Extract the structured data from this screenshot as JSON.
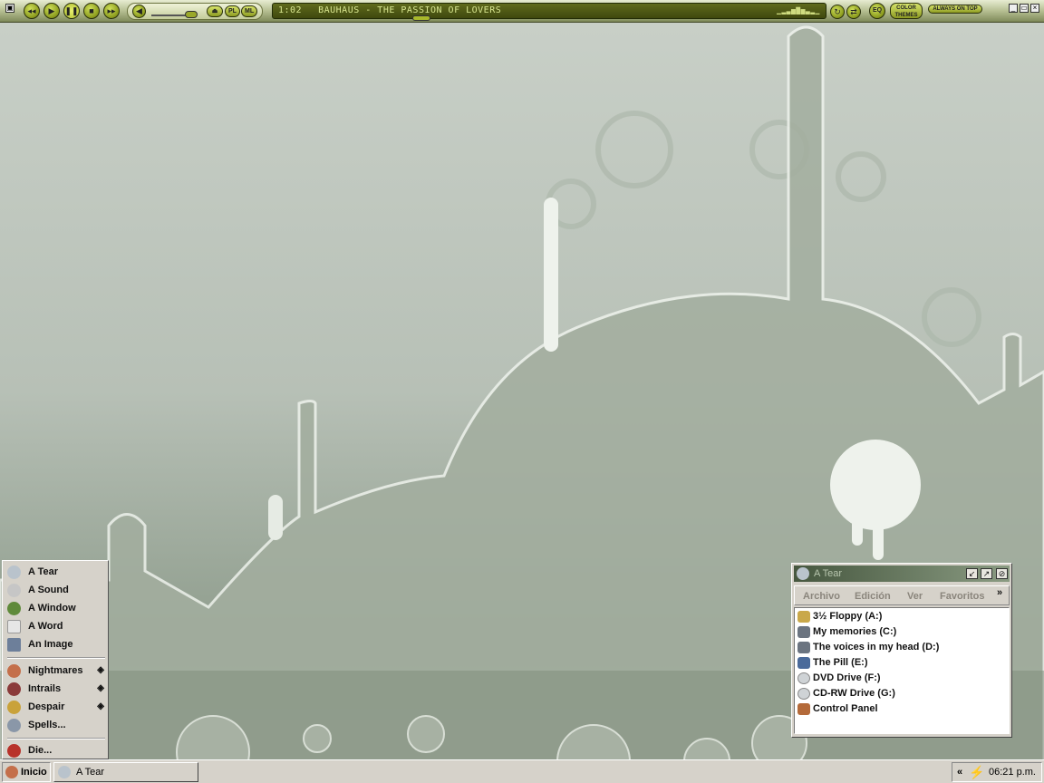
{
  "winamp": {
    "buttons": [
      "previous",
      "play",
      "pause",
      "stop",
      "next"
    ],
    "eject_label": "⏏",
    "pl_label": "PL",
    "ml_label": "ML",
    "time": "1:02",
    "track": "BAUHAUS - THE PASSION OF LOVERS",
    "eq_label": "EQ",
    "color_themes_label": "COLOR THEMES",
    "always_on_top_label": "ALWAYS ON TOP"
  },
  "start_menu": {
    "items": [
      {
        "label": "A Tear",
        "icon": "speaker-icon",
        "color": "#b9c3cc"
      },
      {
        "label": "A Sound",
        "icon": "note-icon",
        "color": "#c6c6c6"
      },
      {
        "label": "A Window",
        "icon": "globe-icon",
        "color": "#5f8a3a"
      },
      {
        "label": "A Word",
        "icon": "book-icon",
        "color": "#e6e6e6"
      },
      {
        "label": "An Image",
        "icon": "picture-icon",
        "color": "#6d7f9a"
      }
    ],
    "submenus": [
      {
        "label": "Nightmares",
        "icon": "brain-icon",
        "color": "#c46f4a",
        "arrow": "◈"
      },
      {
        "label": "Intrails",
        "icon": "gear-icon",
        "color": "#8a3a3a",
        "arrow": "◈"
      },
      {
        "label": "Despair",
        "icon": "magnifier-icon",
        "color": "#c9a23a",
        "arrow": "◈"
      },
      {
        "label": "Spells...",
        "icon": "run-icon",
        "color": "#8a97a8"
      }
    ],
    "die": {
      "label": "Die...",
      "icon": "shutdown-icon",
      "color": "#b8322a"
    }
  },
  "window": {
    "title": "A Tear",
    "menu": [
      "Archivo",
      "Edición",
      "Ver",
      "Favoritos"
    ],
    "more": "»",
    "items": [
      {
        "label": "3½ Floppy (A:)",
        "icon": "floppy-icon",
        "color": "#c9a84a"
      },
      {
        "label": "My memories (C:)",
        "icon": "hard-drive-icon",
        "color": "#6b7480"
      },
      {
        "label": "The voices in my head (D:)",
        "icon": "hard-drive-icon",
        "color": "#6b7480"
      },
      {
        "label": "The Pill (E:)",
        "icon": "network-drive-icon",
        "color": "#4a6a9a"
      },
      {
        "label": "DVD Drive (F:)",
        "icon": "cd-icon",
        "color": "#cfd3d6"
      },
      {
        "label": "CD-RW Drive (G:)",
        "icon": "cd-icon",
        "color": "#cfd3d6"
      },
      {
        "label": "Control Panel",
        "icon": "wrench-icon",
        "color": "#b46a3a"
      }
    ]
  },
  "taskbar": {
    "start_label": "Inicio",
    "task_label": "A Tear",
    "tray_expand": "«",
    "clock": "06:21 p.m."
  }
}
